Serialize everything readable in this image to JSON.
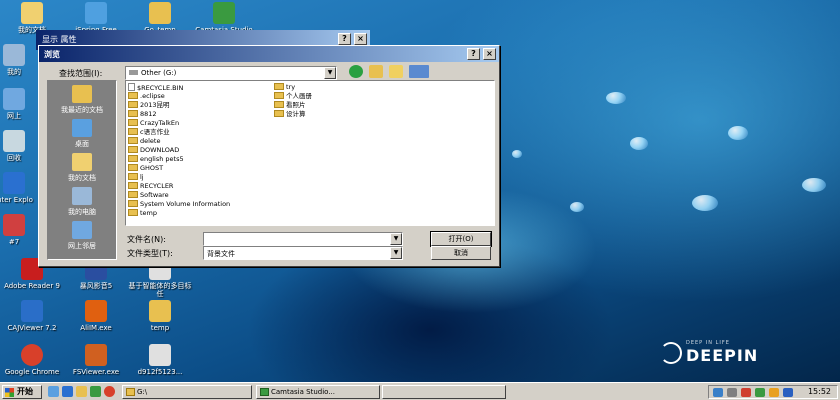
{
  "desktop": {
    "icons": [
      {
        "label": "我的文档",
        "icon": "my-documents-icon",
        "color": "#f0d070"
      },
      {
        "label": "iSpring Free",
        "icon": "ispring-icon",
        "color": "#4fa0e0"
      },
      {
        "label": "Go_temp",
        "icon": "folder-shortcut-icon",
        "color": "#e8c050"
      },
      {
        "label": "Camtasia Studio 7",
        "icon": "camtasia-icon",
        "color": "#3a9a40"
      },
      {
        "label": "我的",
        "icon": "my-computer-icon",
        "color": "#9ab8d8"
      },
      {
        "label": "网上",
        "icon": "network-icon",
        "color": "#70a8e0"
      },
      {
        "label": "回收",
        "icon": "recycle-bin-icon",
        "color": "#c8d8e0"
      },
      {
        "label": "Inter Explo",
        "icon": "ie-icon",
        "color": "#2a70d0"
      },
      {
        "label": "#7",
        "icon": "app-icon",
        "color": "#d04040"
      },
      {
        "label": "Adobe Reader 9",
        "icon": "adobe-reader-icon",
        "color": "#c81e1e"
      },
      {
        "label": "暴风影音5",
        "icon": "baofeng-icon",
        "color": "#2a4ea0"
      },
      {
        "label": "基于智能体的多目标任",
        "icon": "pdf-file-icon",
        "color": "#e0e0e0"
      },
      {
        "label": "CAJViewer 7.2",
        "icon": "cajviewer-icon",
        "color": "#2a6ec8"
      },
      {
        "label": "AliIM.exe",
        "icon": "aliim-icon",
        "color": "#e06010"
      },
      {
        "label": "temp",
        "icon": "folder-icon",
        "color": "#e8c050"
      },
      {
        "label": "Google Chrome",
        "icon": "chrome-icon",
        "color": "#d8402a"
      },
      {
        "label": "FSViewer.exe",
        "icon": "fsviewer-icon",
        "color": "#d06020"
      },
      {
        "label": "d912f5123...",
        "icon": "pdf-file-icon",
        "color": "#e0e0e0"
      }
    ],
    "logo": {
      "small": "DEEP IN LIFE",
      "big": "DEEPIN"
    }
  },
  "back_window": {
    "title": "显示 属性"
  },
  "dialog": {
    "title": "浏览",
    "look_in_label": "查找范围(I):",
    "look_in_value": "Other (G:)",
    "places": [
      {
        "label": "我最近的文档",
        "icon": "recent-documents-icon"
      },
      {
        "label": "桌面",
        "icon": "desktop-icon"
      },
      {
        "label": "我的文档",
        "icon": "my-documents-icon"
      },
      {
        "label": "我的电脑",
        "icon": "my-computer-icon"
      },
      {
        "label": "网上邻居",
        "icon": "network-places-icon"
      }
    ],
    "files_col1": [
      {
        "name": "$RECYCLE.BIN",
        "type": "folder"
      },
      {
        "name": ".eclipse",
        "type": "folder"
      },
      {
        "name": "2013昆明",
        "type": "folder"
      },
      {
        "name": "8812",
        "type": "folder"
      },
      {
        "name": "CrazyTalkEn",
        "type": "folder"
      },
      {
        "name": "c语言作业",
        "type": "folder"
      },
      {
        "name": "delete",
        "type": "folder"
      },
      {
        "name": "DOWNLOAD",
        "type": "folder"
      },
      {
        "name": "english pets5",
        "type": "folder"
      },
      {
        "name": "GHOST",
        "type": "folder"
      },
      {
        "name": "lj",
        "type": "folder"
      },
      {
        "name": "RECYCLER",
        "type": "folder"
      },
      {
        "name": "Software",
        "type": "folder"
      },
      {
        "name": "System Volume Information",
        "type": "folder"
      },
      {
        "name": "temp",
        "type": "folder"
      }
    ],
    "files_col2": [
      {
        "name": "try",
        "type": "folder"
      },
      {
        "name": "个人画册",
        "type": "folder"
      },
      {
        "name": "看照片",
        "type": "folder"
      },
      {
        "name": "设计算",
        "type": "folder"
      }
    ],
    "filename_label": "文件名(N):",
    "filename_value": "",
    "filetype_label": "文件类型(T):",
    "filetype_value": "背景文件",
    "open_button": "打开(O)",
    "cancel_button": "取消"
  },
  "taskbar": {
    "start_label": "开始",
    "tasks": [
      {
        "label": "G:\\",
        "icon": "folder-icon"
      },
      {
        "label": "",
        "icon": "blank-task-icon"
      },
      {
        "label": "Camtasia Studio...",
        "icon": "camtasia-icon"
      },
      {
        "label": "",
        "icon": "blank-task-icon"
      }
    ],
    "clock": "15:52"
  },
  "colors": {
    "titlebar": "#0a246a",
    "face": "#d4d0c8",
    "folder": "#e8c050"
  }
}
